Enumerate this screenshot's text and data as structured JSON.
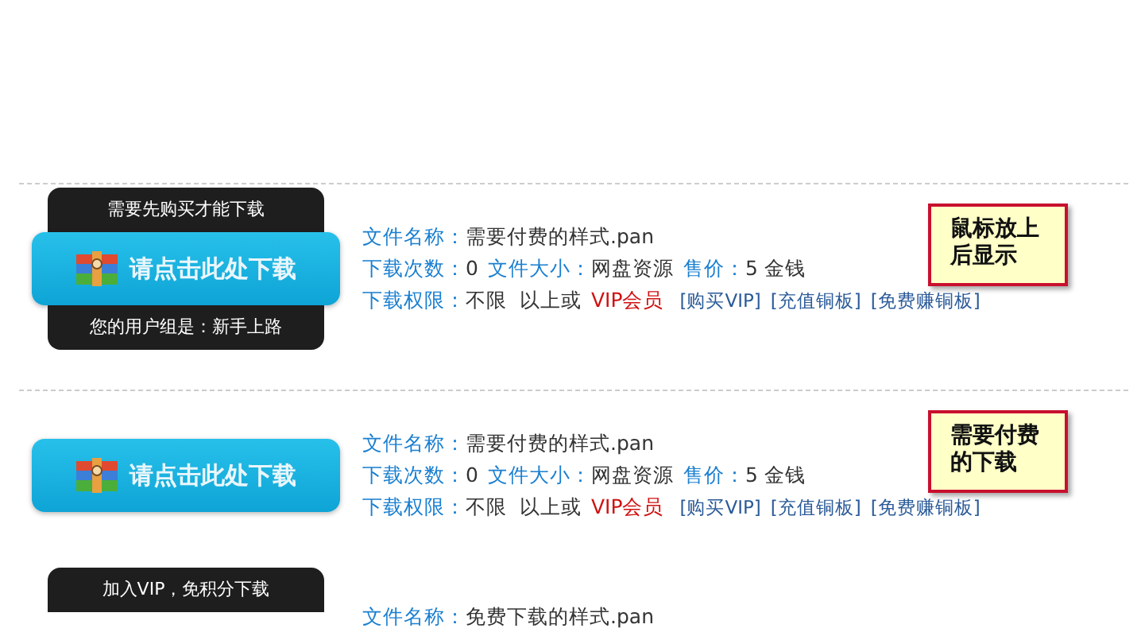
{
  "items": [
    {
      "divider": true,
      "top_tip": "需要先购买才能下载",
      "button": "请点击此处下载",
      "bottom_tip": "您的用户组是：新手上路",
      "name_label": "文件名称：",
      "name": "需要付费的样式.pan",
      "downloads_label": "下载次数：",
      "downloads": "0",
      "size_label": "文件大小：",
      "size": "网盘资源",
      "price_label": "售价：",
      "price": "5 金钱",
      "permission_label": "下载权限：",
      "permission": "不限  以上或",
      "vip": "VIP会员",
      "links": [
        "[购买VIP]",
        "[充值铜板]",
        "[免费赚铜板]"
      ],
      "note": "鼠标放上后显示"
    },
    {
      "divider": true,
      "button": "请点击此处下载",
      "name_label": "文件名称：",
      "name": "需要付费的样式.pan",
      "downloads_label": "下载次数：",
      "downloads": "0",
      "size_label": "文件大小：",
      "size": "网盘资源",
      "price_label": "售价：",
      "price": "5 金钱",
      "permission_label": "下载权限：",
      "permission": "不限  以上或",
      "vip": "VIP会员",
      "links": [
        "[购买VIP]",
        "[充值铜板]",
        "[免费赚铜板]"
      ],
      "note": "需要付费的下载"
    },
    {
      "divider": false,
      "top_tip": "加入VIP，免积分下载",
      "name_label": "文件名称：",
      "name": "免费下载的样式.pan"
    }
  ]
}
